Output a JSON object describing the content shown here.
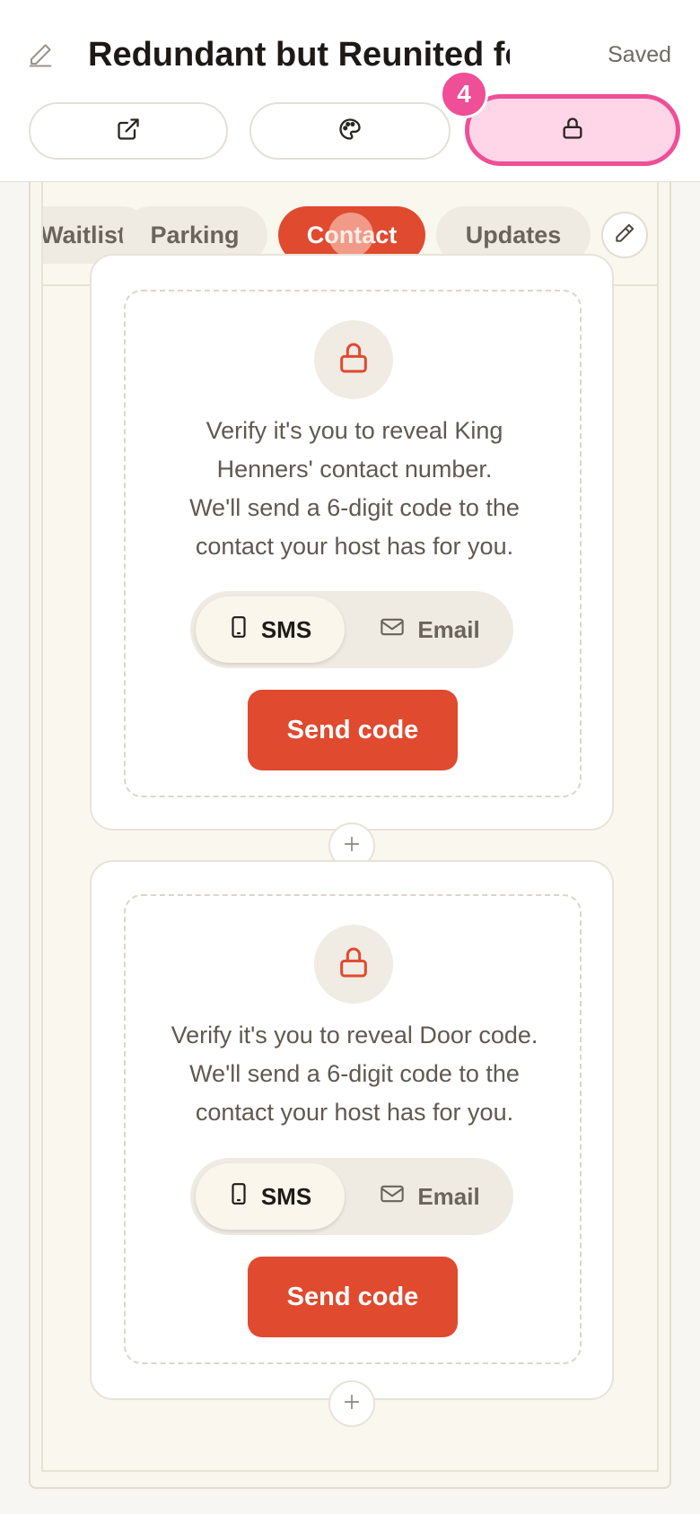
{
  "header": {
    "title": "Redundant but Reunited fo",
    "status": "Saved",
    "step_badge": "4"
  },
  "toolbar": {
    "buttons": [
      {
        "icon": "external-link-icon"
      },
      {
        "icon": "palette-icon"
      },
      {
        "icon": "lock-icon",
        "highlighted": true
      }
    ]
  },
  "tabs": [
    {
      "label": "Waitlist"
    },
    {
      "label": "Parking"
    },
    {
      "label": "Contact",
      "active": true
    },
    {
      "label": "Updates"
    }
  ],
  "blocks": [
    {
      "message_lines": [
        "Verify it's you to reveal King",
        "Henners' contact number.",
        "We'll send a 6-digit code to the",
        "contact your host has for you."
      ],
      "sms_label": "SMS",
      "email_label": "Email",
      "send_label": "Send code"
    },
    {
      "message_lines": [
        "Verify it's you to reveal Door code.",
        "We'll send a 6-digit code to the",
        "contact your host has for you."
      ],
      "sms_label": "SMS",
      "email_label": "Email",
      "send_label": "Send code"
    }
  ],
  "colors": {
    "accent": "#e04a2f",
    "highlight": "#ee4f96",
    "highlight_bg": "#ffd6e8"
  }
}
